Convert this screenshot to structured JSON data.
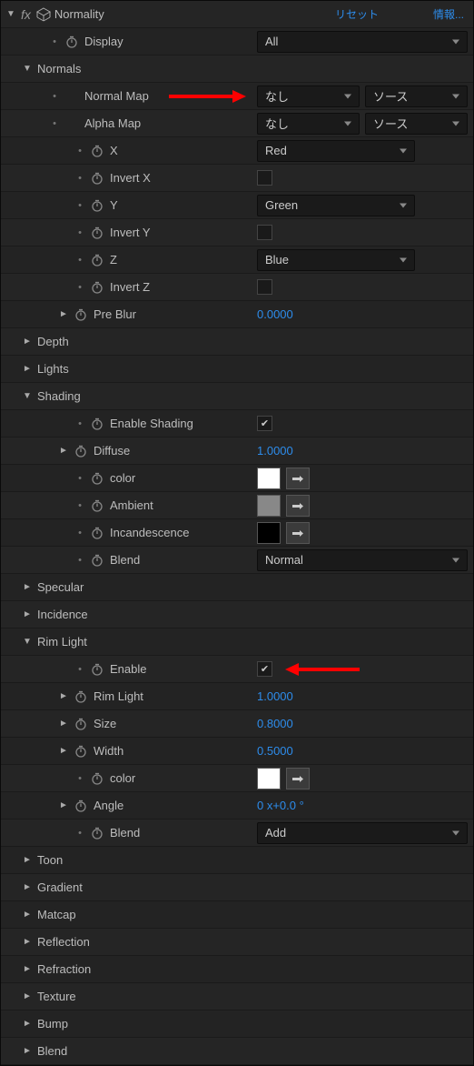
{
  "header": {
    "title": "Normality",
    "reset": "リセット",
    "info": "情報..."
  },
  "display": {
    "label": "Display",
    "value": "All"
  },
  "normals": {
    "label": "Normals",
    "normalMap": {
      "label": "Normal Map",
      "value": "なし",
      "src": "ソース"
    },
    "alphaMap": {
      "label": "Alpha Map",
      "value": "なし",
      "src": "ソース"
    },
    "x": {
      "label": "X",
      "value": "Red"
    },
    "invertX": {
      "label": "Invert X"
    },
    "y": {
      "label": "Y",
      "value": "Green"
    },
    "invertY": {
      "label": "Invert Y"
    },
    "z": {
      "label": "Z",
      "value": "Blue"
    },
    "invertZ": {
      "label": "Invert Z"
    },
    "preBlur": {
      "label": "Pre Blur",
      "value": "0.0000"
    }
  },
  "depth": {
    "label": "Depth"
  },
  "lights": {
    "label": "Lights"
  },
  "shading": {
    "label": "Shading",
    "enable": {
      "label": "Enable Shading"
    },
    "diffuse": {
      "label": "Diffuse",
      "value": "1.0000"
    },
    "color": {
      "label": "color"
    },
    "ambient": {
      "label": "Ambient"
    },
    "incandescence": {
      "label": "Incandescence"
    },
    "blend": {
      "label": "Blend",
      "value": "Normal"
    }
  },
  "specular": {
    "label": "Specular"
  },
  "incidence": {
    "label": "Incidence"
  },
  "rim": {
    "label": "Rim Light",
    "enable": {
      "label": "Enable"
    },
    "rimLight": {
      "label": "Rim Light",
      "value": "1.0000"
    },
    "size": {
      "label": "Size",
      "value": "0.8000"
    },
    "width": {
      "label": "Width",
      "value": "0.5000"
    },
    "color": {
      "label": "color"
    },
    "angle": {
      "label": "Angle",
      "value": "0 x+0.0 °"
    },
    "blend": {
      "label": "Blend",
      "value": "Add"
    }
  },
  "toon": {
    "label": "Toon"
  },
  "gradient": {
    "label": "Gradient"
  },
  "matcap": {
    "label": "Matcap"
  },
  "reflection": {
    "label": "Reflection"
  },
  "refraction": {
    "label": "Refraction"
  },
  "texture": {
    "label": "Texture"
  },
  "bump": {
    "label": "Bump"
  },
  "blend": {
    "label": "Blend"
  }
}
